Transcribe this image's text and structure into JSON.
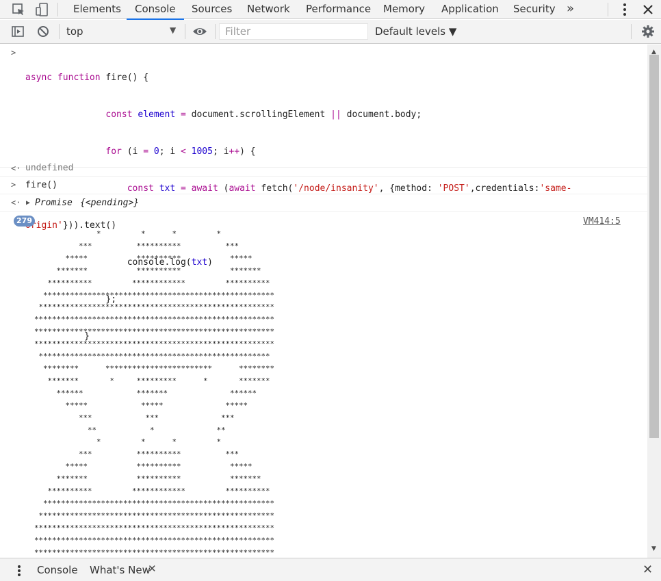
{
  "tabs": {
    "elements": "Elements",
    "console": "Console",
    "sources": "Sources",
    "network": "Network",
    "performance": "Performance",
    "memory": "Memory",
    "application": "Application",
    "security": "Security",
    "more": "»"
  },
  "toolbar": {
    "context": "top",
    "filter_placeholder": "Filter",
    "levels": "Default levels ▼"
  },
  "console": {
    "code_lines": [
      "async function fire() {",
      "                const element = document.scrollingElement || document.body;",
      "                for (i = 0; i < 1005; i++) {",
      "                    const txt = await (await fetch('/node/insanity', {method: 'POST',credentials:'same-",
      "origin'})).text()",
      "                    console.log(txt)",
      "                };",
      "            }"
    ],
    "result1": "undefined",
    "input2": "fire()",
    "result2_label": "Promise",
    "result2_value": "{<pending>}",
    "badge_count": "279",
    "source_link": "VM414:5",
    "ascii_art": "                *         *      *         *\n            ***          **********          ***\n         *****           **********           *****\n       *******           **********           *******\n     **********         ************         **********\n    ****************************************************\n   *****************************************************\n  ******************************************************\n  ******************************************************\n  ******************************************************\n   ****************************************************\n    ********      ************************      ********\n     *******       *     *********      *       *******\n       ******            *******              ******\n         *****            *****              *****\n            ***            ***              ***\n              **            *              **\n                *         *      *         *\n            ***          **********          ***\n         *****           **********           *****\n       *******           **********           *******\n     **********         ************         **********\n    ****************************************************\n   *****************************************************\n  ******************************************************\n  ******************************************************\n  ******************************************************"
  },
  "drawer": {
    "console_tab": "Console",
    "whats_new_tab": "What's New"
  }
}
